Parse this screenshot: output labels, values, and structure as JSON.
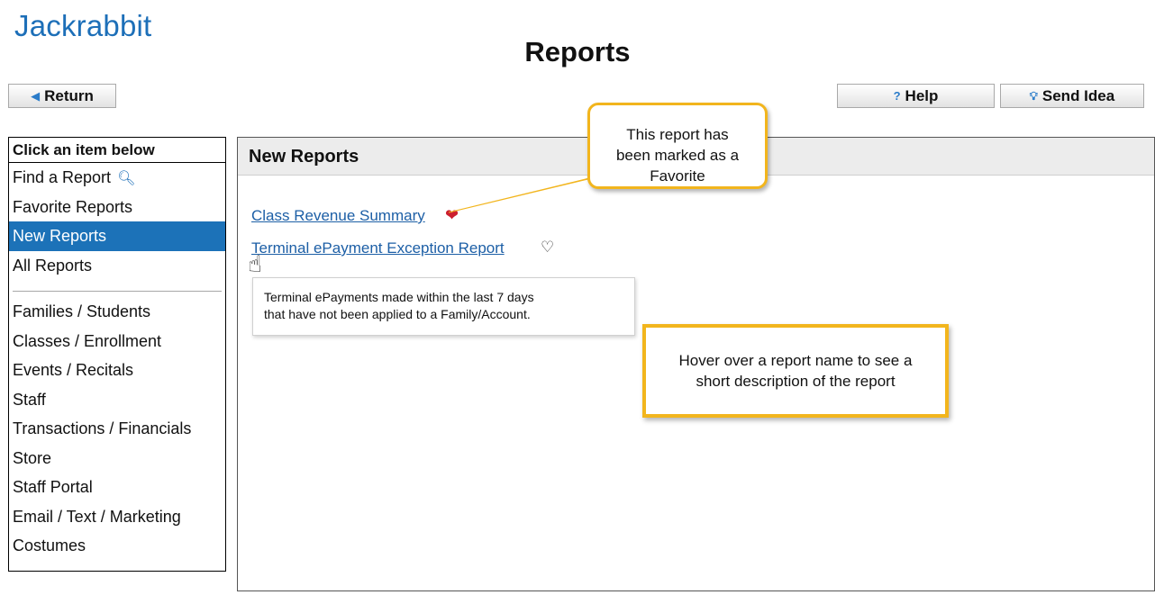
{
  "app": {
    "logo": "Jackrabbit",
    "title": "Reports"
  },
  "toolbar": {
    "return_label": "Return",
    "help_label": "Help",
    "idea_label": "Send Idea"
  },
  "sidebar": {
    "header": "Click an item below",
    "top_items": [
      {
        "label": "Find a Report",
        "icon": "search-icon"
      },
      {
        "label": "Favorite Reports"
      },
      {
        "label": "New Reports",
        "active": true
      },
      {
        "label": "All Reports"
      }
    ],
    "categories": [
      "Families / Students",
      "Classes / Enrollment",
      "Events / Recitals",
      "Staff",
      "Transactions / Financials",
      "Store",
      "Staff Portal",
      "Email / Text / Marketing",
      "Costumes"
    ]
  },
  "main": {
    "section_title": "New Reports",
    "reports": [
      {
        "name": "Class Revenue Summary",
        "favorite": true
      },
      {
        "name": "Terminal ePayment Exception Report",
        "favorite": false
      }
    ],
    "tooltip": {
      "line1": "Terminal ePayments made within the last 7 days",
      "line2": "that have not been applied to a Family/Account."
    }
  },
  "callouts": {
    "favorite": {
      "line1": "This report has",
      "line2": "been marked as a",
      "line3": "Favorite"
    },
    "hover": {
      "line1": "Hover over a report name to see a",
      "line2": "short description of the report"
    }
  },
  "colors": {
    "brand": "#1d6fb8",
    "active_item": "#1c72b8",
    "favorite_heart": "#cc1f2f",
    "callout_border": "#f2b51d",
    "link": "#1d5fa6"
  }
}
